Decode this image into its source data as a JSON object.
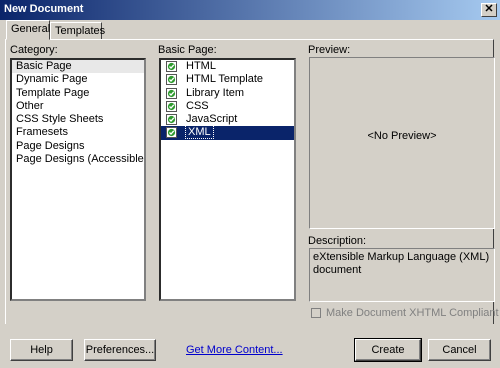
{
  "window": {
    "title": "New Document",
    "close_glyph": "✕"
  },
  "tabs": [
    {
      "label": "General",
      "active": true
    },
    {
      "label": "Templates",
      "active": false
    }
  ],
  "category": {
    "label": "Category:",
    "items": [
      "Basic Page",
      "Dynamic Page",
      "Template Page",
      "Other",
      "CSS Style Sheets",
      "Framesets",
      "Page Designs",
      "Page Designs (Accessible)"
    ],
    "selected": "Basic Page"
  },
  "basic_page": {
    "label": "Basic Page:",
    "items": [
      "HTML",
      "HTML Template",
      "Library Item",
      "CSS",
      "JavaScript",
      "XML"
    ],
    "selected": "XML",
    "icon": "document-icon"
  },
  "preview": {
    "label": "Preview:",
    "text": "<No Preview>"
  },
  "description": {
    "label": "Description:",
    "text": "eXtensible Markup Language (XML) document"
  },
  "xhtml_checkbox": {
    "label": "Make Document XHTML Compliant",
    "checked": false,
    "enabled": false
  },
  "buttons": {
    "help": "Help",
    "preferences": "Preferences...",
    "create": "Create",
    "cancel": "Cancel"
  },
  "link": {
    "get_more": "Get More Content..."
  },
  "colors": {
    "dialog_bg": "#d4d0c8",
    "titlebar": "#0a246a",
    "selection": "#0a246a",
    "link": "#0000cc"
  }
}
